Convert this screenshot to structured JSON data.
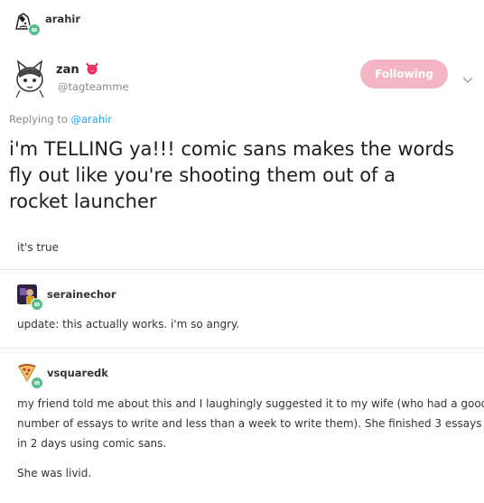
{
  "header": {
    "username": "arahir"
  },
  "tweet": {
    "display_name": "zan",
    "handle": "@tagteamme",
    "follow_button": "Following",
    "reply_prefix": "Replying to",
    "reply_to": "@arahir",
    "text_line1": "i'm TELLING ya!!! comic sans makes the words",
    "text_line2": "fly out like you're shooting them out of a",
    "text_line3": "rocket launcher",
    "accent_color": "#1da1f2",
    "button_color": "#f3b4c4"
  },
  "posts": [
    {
      "username": "",
      "body": [
        "it's true"
      ]
    },
    {
      "username": "serainechor",
      "body": [
        "update: this actually works. i'm so angry."
      ]
    },
    {
      "username": "vsquaredk",
      "body": [
        "my friend told me about this and I laughingly suggested it to my wife (who had a good",
        "number of essays to write and less than a week to write them). She finished 3 essays",
        "in 2 days using comic sans.",
        "She was livid."
      ]
    }
  ],
  "colors": {
    "reblog_badge": "#56bc8a",
    "divider": "#e7e7e7"
  }
}
